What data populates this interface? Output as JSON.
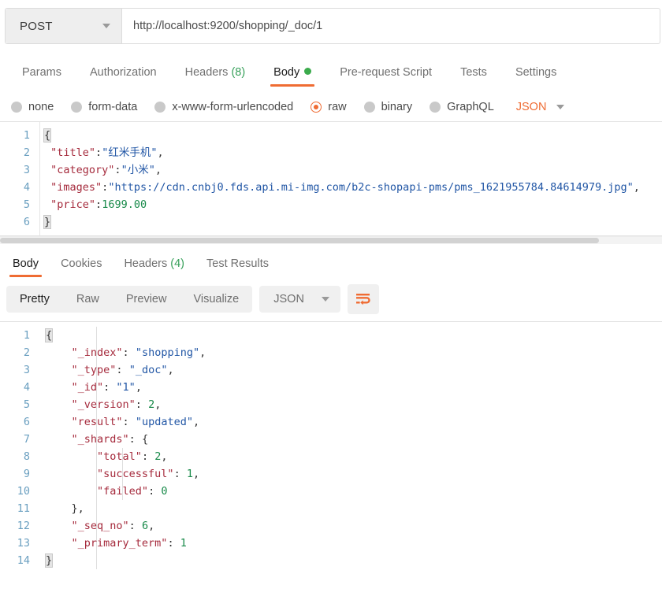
{
  "request_bar": {
    "method": "POST",
    "method_icon": "chevron-down-icon",
    "url": "http://localhost:9200/shopping/_doc/1"
  },
  "request_tabs": [
    {
      "label": "Params",
      "active": false
    },
    {
      "label": "Authorization",
      "active": false
    },
    {
      "label": "Headers",
      "count": "(8)",
      "active": false
    },
    {
      "label": "Body",
      "active": true,
      "indicator": "green-dot"
    },
    {
      "label": "Pre-request Script",
      "active": false
    },
    {
      "label": "Tests",
      "active": false
    },
    {
      "label": "Settings",
      "active": false
    }
  ],
  "body_types": {
    "options": [
      {
        "label": "none",
        "selected": false
      },
      {
        "label": "form-data",
        "selected": false
      },
      {
        "label": "x-www-form-urlencoded",
        "selected": false
      },
      {
        "label": "raw",
        "selected": true
      },
      {
        "label": "binary",
        "selected": false
      },
      {
        "label": "GraphQL",
        "selected": false
      }
    ],
    "format": "JSON",
    "format_icon": "chevron-down-icon"
  },
  "request_body": {
    "line_numbers": [
      "1",
      "2",
      "3",
      "4",
      "5",
      "6"
    ],
    "lines": [
      [
        {
          "t": "{",
          "c": "p",
          "hl": true
        }
      ],
      [
        {
          "t": " ",
          "c": "p"
        },
        {
          "t": "\"title\"",
          "c": "k"
        },
        {
          "t": ":",
          "c": "p"
        },
        {
          "t": "\"红米手机\"",
          "c": "s"
        },
        {
          "t": ",",
          "c": "p"
        }
      ],
      [
        {
          "t": " ",
          "c": "p"
        },
        {
          "t": "\"category\"",
          "c": "k"
        },
        {
          "t": ":",
          "c": "p"
        },
        {
          "t": "\"小米\"",
          "c": "s"
        },
        {
          "t": ",",
          "c": "p"
        }
      ],
      [
        {
          "t": " ",
          "c": "p"
        },
        {
          "t": "\"images\"",
          "c": "k"
        },
        {
          "t": ":",
          "c": "p"
        },
        {
          "t": "\"https://cdn.cnbj0.fds.api.mi-img.com/b2c-shopapi-pms/pms_1621955784.84614979.jpg\"",
          "c": "s"
        },
        {
          "t": ",",
          "c": "p"
        }
      ],
      [
        {
          "t": " ",
          "c": "p"
        },
        {
          "t": "\"price\"",
          "c": "k"
        },
        {
          "t": ":",
          "c": "p"
        },
        {
          "t": "1699.00",
          "c": "n"
        }
      ],
      [
        {
          "t": "}",
          "c": "p",
          "hl": true
        }
      ]
    ]
  },
  "response_tabs": [
    {
      "label": "Body",
      "active": true
    },
    {
      "label": "Cookies",
      "active": false
    },
    {
      "label": "Headers",
      "count": "(4)",
      "active": false
    },
    {
      "label": "Test Results",
      "active": false
    }
  ],
  "response_toolbar": {
    "views": [
      {
        "label": "Pretty",
        "active": true
      },
      {
        "label": "Raw",
        "active": false
      },
      {
        "label": "Preview",
        "active": false
      },
      {
        "label": "Visualize",
        "active": false
      }
    ],
    "format": "JSON",
    "format_icon": "chevron-down-icon",
    "wrap_icon": "word-wrap-icon"
  },
  "response_body": {
    "line_numbers": [
      "1",
      "2",
      "3",
      "4",
      "5",
      "6",
      "7",
      "8",
      "9",
      "10",
      "11",
      "12",
      "13",
      "14"
    ],
    "lines": [
      [
        {
          "t": "{",
          "c": "p",
          "hl": true
        }
      ],
      [
        {
          "t": "    ",
          "c": "p"
        },
        {
          "t": "\"_index\"",
          "c": "k"
        },
        {
          "t": ": ",
          "c": "p"
        },
        {
          "t": "\"shopping\"",
          "c": "s"
        },
        {
          "t": ",",
          "c": "p"
        }
      ],
      [
        {
          "t": "    ",
          "c": "p"
        },
        {
          "t": "\"_type\"",
          "c": "k"
        },
        {
          "t": ": ",
          "c": "p"
        },
        {
          "t": "\"_doc\"",
          "c": "s"
        },
        {
          "t": ",",
          "c": "p"
        }
      ],
      [
        {
          "t": "    ",
          "c": "p"
        },
        {
          "t": "\"_id\"",
          "c": "k"
        },
        {
          "t": ": ",
          "c": "p"
        },
        {
          "t": "\"1\"",
          "c": "s"
        },
        {
          "t": ",",
          "c": "p"
        }
      ],
      [
        {
          "t": "    ",
          "c": "p"
        },
        {
          "t": "\"_version\"",
          "c": "k"
        },
        {
          "t": ": ",
          "c": "p"
        },
        {
          "t": "2",
          "c": "n"
        },
        {
          "t": ",",
          "c": "p"
        }
      ],
      [
        {
          "t": "    ",
          "c": "p"
        },
        {
          "t": "\"result\"",
          "c": "k"
        },
        {
          "t": ": ",
          "c": "p"
        },
        {
          "t": "\"updated\"",
          "c": "s"
        },
        {
          "t": ",",
          "c": "p"
        }
      ],
      [
        {
          "t": "    ",
          "c": "p"
        },
        {
          "t": "\"_shards\"",
          "c": "k"
        },
        {
          "t": ": ",
          "c": "p"
        },
        {
          "t": "{",
          "c": "p"
        }
      ],
      [
        {
          "t": "        ",
          "c": "p"
        },
        {
          "t": "\"total\"",
          "c": "k"
        },
        {
          "t": ": ",
          "c": "p"
        },
        {
          "t": "2",
          "c": "n"
        },
        {
          "t": ",",
          "c": "p"
        }
      ],
      [
        {
          "t": "        ",
          "c": "p"
        },
        {
          "t": "\"successful\"",
          "c": "k"
        },
        {
          "t": ": ",
          "c": "p"
        },
        {
          "t": "1",
          "c": "n"
        },
        {
          "t": ",",
          "c": "p"
        }
      ],
      [
        {
          "t": "        ",
          "c": "p"
        },
        {
          "t": "\"failed\"",
          "c": "k"
        },
        {
          "t": ": ",
          "c": "p"
        },
        {
          "t": "0",
          "c": "n"
        }
      ],
      [
        {
          "t": "    ",
          "c": "p"
        },
        {
          "t": "},",
          "c": "p"
        }
      ],
      [
        {
          "t": "    ",
          "c": "p"
        },
        {
          "t": "\"_seq_no\"",
          "c": "k"
        },
        {
          "t": ": ",
          "c": "p"
        },
        {
          "t": "6",
          "c": "n"
        },
        {
          "t": ",",
          "c": "p"
        }
      ],
      [
        {
          "t": "    ",
          "c": "p"
        },
        {
          "t": "\"_primary_term\"",
          "c": "k"
        },
        {
          "t": ": ",
          "c": "p"
        },
        {
          "t": "1",
          "c": "n"
        }
      ],
      [
        {
          "t": "}",
          "c": "p",
          "hl": true
        }
      ]
    ]
  },
  "colors": {
    "accent": "#ef6c33",
    "green": "#3bab4c",
    "key": "#a52a3c",
    "string": "#2156a5",
    "number": "#198a4a",
    "gutter": "#6a9fc0"
  }
}
